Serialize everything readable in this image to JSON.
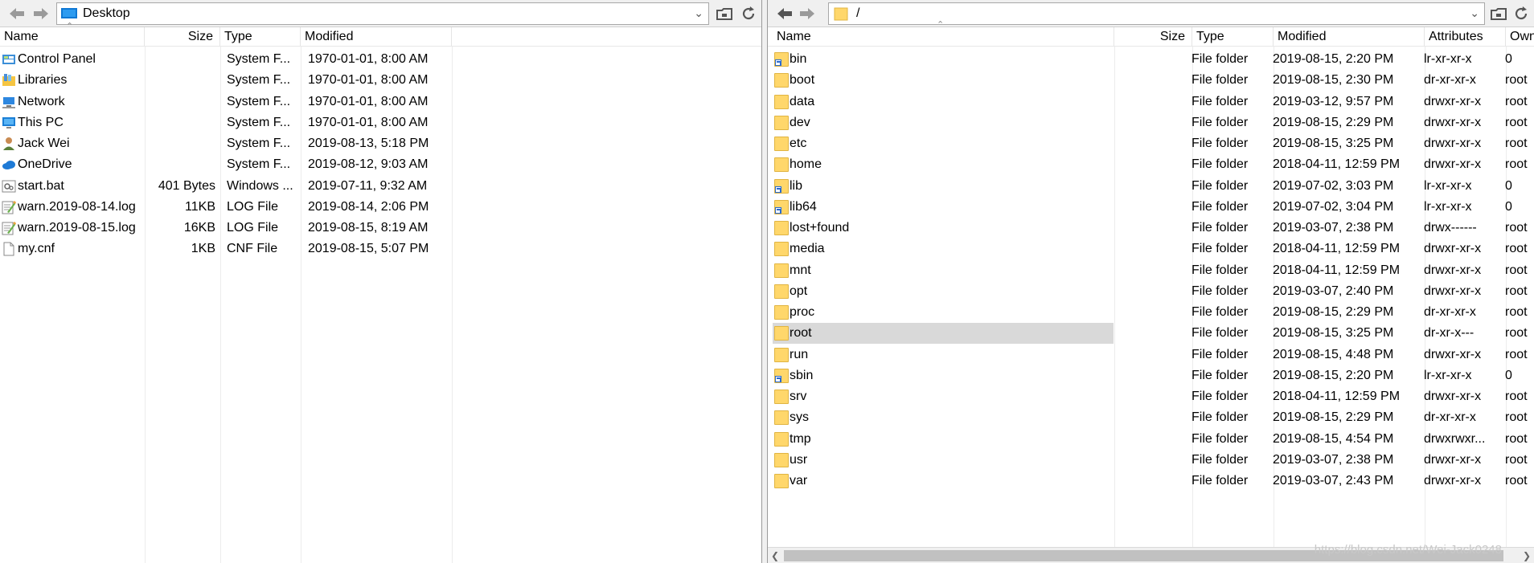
{
  "left": {
    "path": "Desktop",
    "columns": {
      "name": "Name",
      "size": "Size",
      "type": "Type",
      "modified": "Modified"
    },
    "rows": [
      {
        "name": "Control Panel",
        "size": "",
        "type": "System F...",
        "modified": "1970-01-01, 8:00 AM",
        "icon": "control-panel-icon"
      },
      {
        "name": "Libraries",
        "size": "",
        "type": "System F...",
        "modified": "1970-01-01, 8:00 AM",
        "icon": "libraries-icon"
      },
      {
        "name": "Network",
        "size": "",
        "type": "System F...",
        "modified": "1970-01-01, 8:00 AM",
        "icon": "network-icon"
      },
      {
        "name": "This PC",
        "size": "",
        "type": "System F...",
        "modified": "1970-01-01, 8:00 AM",
        "icon": "computer-icon"
      },
      {
        "name": "Jack Wei",
        "size": "",
        "type": "System F...",
        "modified": "2019-08-13, 5:18 PM",
        "icon": "user-icon"
      },
      {
        "name": "OneDrive",
        "size": "",
        "type": "System F...",
        "modified": "2019-08-12, 9:03 AM",
        "icon": "cloud-icon"
      },
      {
        "name": "start.bat",
        "size": "401 Bytes",
        "type": "Windows ...",
        "modified": "2019-07-11, 9:32 AM",
        "icon": "batch-file-icon"
      },
      {
        "name": "warn.2019-08-14.log",
        "size": "11KB",
        "type": "LOG File",
        "modified": "2019-08-14, 2:06 PM",
        "icon": "log-file-icon"
      },
      {
        "name": "warn.2019-08-15.log",
        "size": "16KB",
        "type": "LOG File",
        "modified": "2019-08-15, 8:19 AM",
        "icon": "log-file-icon"
      },
      {
        "name": "my.cnf",
        "size": "1KB",
        "type": "CNF File",
        "modified": "2019-08-15, 5:07 PM",
        "icon": "file-icon"
      }
    ]
  },
  "right": {
    "path": "/",
    "columns": {
      "name": "Name",
      "size": "Size",
      "type": "Type",
      "modified": "Modified",
      "attributes": "Attributes",
      "owner": "Owne"
    },
    "rows": [
      {
        "name": "bin",
        "type": "File folder",
        "modified": "2019-08-15, 2:20 PM",
        "attributes": "lr-xr-xr-x",
        "owner": "0",
        "link": true
      },
      {
        "name": "boot",
        "type": "File folder",
        "modified": "2019-08-15, 2:30 PM",
        "attributes": "dr-xr-xr-x",
        "owner": "root",
        "link": false
      },
      {
        "name": "data",
        "type": "File folder",
        "modified": "2019-03-12, 9:57 PM",
        "attributes": "drwxr-xr-x",
        "owner": "root",
        "link": false
      },
      {
        "name": "dev",
        "type": "File folder",
        "modified": "2019-08-15, 2:29 PM",
        "attributes": "drwxr-xr-x",
        "owner": "root",
        "link": false
      },
      {
        "name": "etc",
        "type": "File folder",
        "modified": "2019-08-15, 3:25 PM",
        "attributes": "drwxr-xr-x",
        "owner": "root",
        "link": false
      },
      {
        "name": "home",
        "type": "File folder",
        "modified": "2018-04-11, 12:59 PM",
        "attributes": "drwxr-xr-x",
        "owner": "root",
        "link": false
      },
      {
        "name": "lib",
        "type": "File folder",
        "modified": "2019-07-02, 3:03 PM",
        "attributes": "lr-xr-xr-x",
        "owner": "0",
        "link": true
      },
      {
        "name": "lib64",
        "type": "File folder",
        "modified": "2019-07-02, 3:04 PM",
        "attributes": "lr-xr-xr-x",
        "owner": "0",
        "link": true
      },
      {
        "name": "lost+found",
        "type": "File folder",
        "modified": "2019-03-07, 2:38 PM",
        "attributes": "drwx------",
        "owner": "root",
        "link": false
      },
      {
        "name": "media",
        "type": "File folder",
        "modified": "2018-04-11, 12:59 PM",
        "attributes": "drwxr-xr-x",
        "owner": "root",
        "link": false
      },
      {
        "name": "mnt",
        "type": "File folder",
        "modified": "2018-04-11, 12:59 PM",
        "attributes": "drwxr-xr-x",
        "owner": "root",
        "link": false
      },
      {
        "name": "opt",
        "type": "File folder",
        "modified": "2019-03-07, 2:40 PM",
        "attributes": "drwxr-xr-x",
        "owner": "root",
        "link": false
      },
      {
        "name": "proc",
        "type": "File folder",
        "modified": "2019-08-15, 2:29 PM",
        "attributes": "dr-xr-xr-x",
        "owner": "root",
        "link": false
      },
      {
        "name": "root",
        "type": "File folder",
        "modified": "2019-08-15, 3:25 PM",
        "attributes": "dr-xr-x---",
        "owner": "root",
        "link": false,
        "selected": true
      },
      {
        "name": "run",
        "type": "File folder",
        "modified": "2019-08-15, 4:48 PM",
        "attributes": "drwxr-xr-x",
        "owner": "root",
        "link": false
      },
      {
        "name": "sbin",
        "type": "File folder",
        "modified": "2019-08-15, 2:20 PM",
        "attributes": "lr-xr-xr-x",
        "owner": "0",
        "link": true
      },
      {
        "name": "srv",
        "type": "File folder",
        "modified": "2018-04-11, 12:59 PM",
        "attributes": "drwxr-xr-x",
        "owner": "root",
        "link": false
      },
      {
        "name": "sys",
        "type": "File folder",
        "modified": "2019-08-15, 2:29 PM",
        "attributes": "dr-xr-xr-x",
        "owner": "root",
        "link": false
      },
      {
        "name": "tmp",
        "type": "File folder",
        "modified": "2019-08-15, 4:54 PM",
        "attributes": "drwxrwxr...",
        "owner": "root",
        "link": false
      },
      {
        "name": "usr",
        "type": "File folder",
        "modified": "2019-03-07, 2:38 PM",
        "attributes": "drwxr-xr-x",
        "owner": "root",
        "link": false
      },
      {
        "name": "var",
        "type": "File folder",
        "modified": "2019-03-07, 2:43 PM",
        "attributes": "drwxr-xr-x",
        "owner": "root",
        "link": false
      }
    ]
  },
  "watermark": "https://blog.csdn.net/Wei-Jack0248"
}
